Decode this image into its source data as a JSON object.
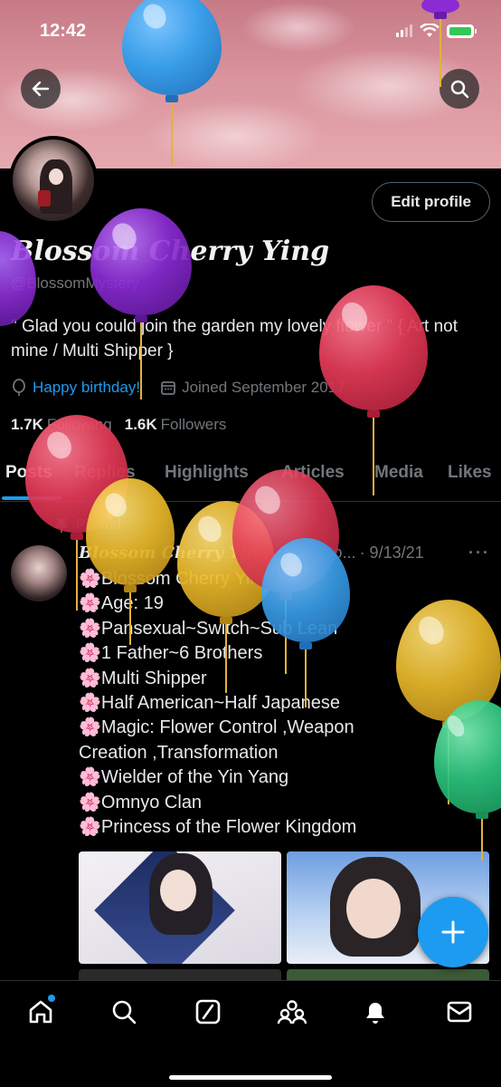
{
  "status_bar": {
    "time": "12:42"
  },
  "profile": {
    "display_name": "Blossom Cherry Ying",
    "handle": "@BlossomMystery",
    "bio": "\" Glad you could join the garden my lovely flower \" { Art not mine / Multi Shipper }",
    "birthday": "Happy birthday!",
    "joined": "Joined September 2017",
    "following_count": "1.7K",
    "following_label": "Following",
    "followers_count": "1.6K",
    "followers_label": "Followers",
    "edit_label": "Edit profile"
  },
  "tabs": [
    "Posts",
    "Replies",
    "Highlights",
    "Articles",
    "Media",
    "Likes"
  ],
  "pinned_label": "Pinned",
  "post": {
    "author": "Blossom Cherry Ying",
    "handle": "@Blosso...",
    "date": "· 9/13/21",
    "more": "···",
    "lines": [
      "Blossom Cherry Ying",
      "Age: 19",
      "Pansexual~Switch~Sub Lean",
      "1 Father~6 Brothers",
      "Multi Shipper",
      "Half American~Half Japanese",
      "Magic: Flower Control ,Weapon",
      "Creation ,Transformation",
      "Wielder of the Yin Yang",
      "Omnyo Clan",
      "Princess of the Flower Kingdom"
    ],
    "flower_emoji": "🌸"
  },
  "icons": {
    "back": "back-arrow-icon",
    "search": "search-icon",
    "fab": "plus-icon",
    "nav": [
      "home-icon",
      "search-icon",
      "grok-icon",
      "communities-icon",
      "notifications-icon",
      "messages-icon"
    ]
  },
  "colors": {
    "accent": "#1d9bf0",
    "balloon_blue": "#3a9ee8",
    "balloon_purple": "#8a2bd3",
    "balloon_red": "#e43a57",
    "balloon_yellow": "#e8b82a",
    "balloon_green": "#2cc47e"
  }
}
